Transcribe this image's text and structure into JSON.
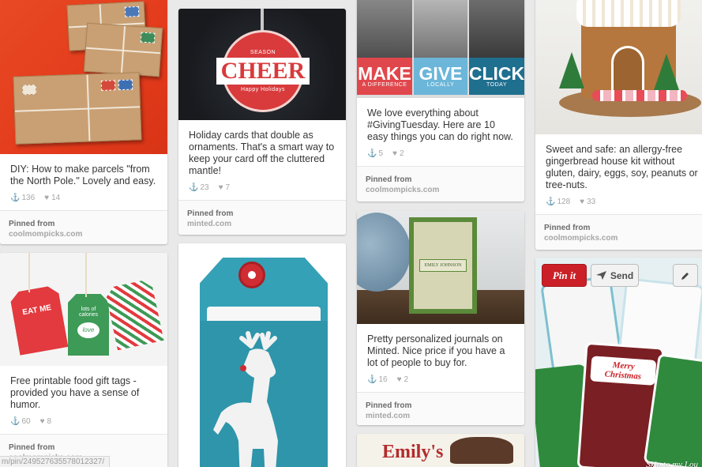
{
  "pins": [
    {
      "id": "parcels",
      "description": "DIY: How to make parcels \"from the North Pole.\" Lovely and easy.",
      "repins": "136",
      "likes": "14",
      "pinned_from_label": "Pinned from",
      "source": "coolmompicks.com"
    },
    {
      "id": "cheer",
      "image_text": {
        "top": "SEASON",
        "main": "CHEER",
        "bottom": "Happy Holidays"
      },
      "description": "Holiday cards that double as ornaments. That's a smart way to keep your card off the cluttered mantle!",
      "repins": "23",
      "likes": "7",
      "pinned_from_label": "Pinned from",
      "source": "minted.com"
    },
    {
      "id": "giving",
      "image_tiles": [
        {
          "title": "MAKE",
          "sub": "A DIFFERENCE",
          "color": "#e0474c"
        },
        {
          "title": "GIVE",
          "sub": "LOCALLY",
          "color": "#6bb6d9"
        },
        {
          "title": "CLICK",
          "sub": "TODAY",
          "color": "#1f6f8f"
        }
      ],
      "description": "We love everything about #GivingTuesday. Here are 10 easy things you can do right now.",
      "repins": "5",
      "likes": "2",
      "pinned_from_label": "Pinned from",
      "source": "coolmompicks.com"
    },
    {
      "id": "gingerbread",
      "description": "Sweet and safe: an allergy-free gingerbread house kit without gluten, dairy, eggs, soy, peanuts or tree-nuts.",
      "repins": "128",
      "likes": "33",
      "pinned_from_label": "Pinned from",
      "source": "coolmompicks.com"
    },
    {
      "id": "journal",
      "image_text": "EMILY JOHNSON",
      "description": "Pretty personalized journals on Minted. Nice price if you have a lot of people to buy for.",
      "repins": "16",
      "likes": "2",
      "pinned_from_label": "Pinned from",
      "source": "minted.com"
    },
    {
      "id": "tags",
      "image_text": {
        "tag1": "EAT ME",
        "tag2": "lots of calories",
        "tag3": "love"
      },
      "description": "Free printable food gift tags - provided you have a sense of humor.",
      "repins": "60",
      "likes": "8",
      "pinned_from_label": "Pinned from",
      "source": "coolmompicks.com"
    },
    {
      "id": "reindeer"
    },
    {
      "id": "emily",
      "image_text": "Emily's"
    },
    {
      "id": "stickers",
      "image_text": {
        "sticker": "Merry Christmas",
        "credit": "Skip to my Lou"
      }
    }
  ],
  "hover_actions": {
    "pin_it_label": "Pin it",
    "send_label": "Send"
  },
  "status_bar_url": "m/pin/249527635578012327/",
  "icons": {
    "repin": "repin-icon",
    "like": "heart-icon",
    "send": "send-icon",
    "edit": "pencil-icon"
  }
}
